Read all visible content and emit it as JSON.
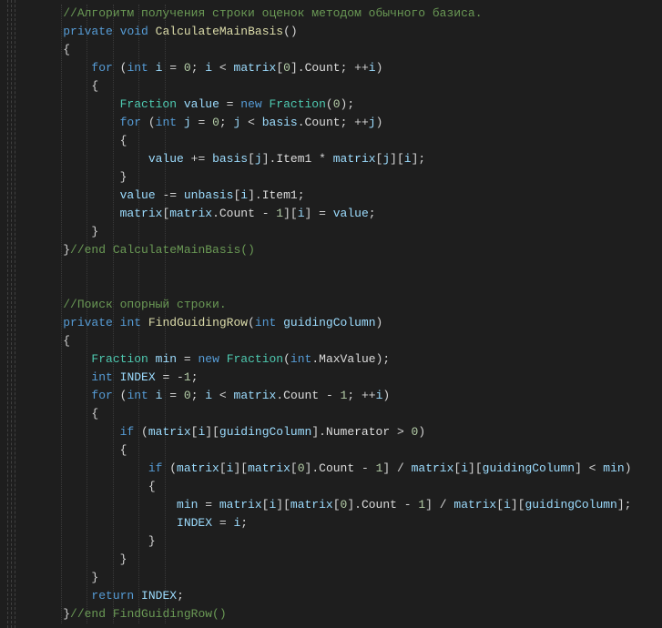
{
  "code": {
    "lines": [
      {
        "indent": 1,
        "spans": [
          {
            "cls": "c-comment",
            "t": "//Алгоритм получения строки оценок методом обычного базиса."
          }
        ]
      },
      {
        "indent": 1,
        "spans": [
          {
            "cls": "c-keyword",
            "t": "private"
          },
          {
            "cls": "c-op",
            "t": " "
          },
          {
            "cls": "c-keyword",
            "t": "void"
          },
          {
            "cls": "c-op",
            "t": " "
          },
          {
            "cls": "c-method",
            "t": "CalculateMainBasis"
          },
          {
            "cls": "c-punc",
            "t": "()"
          }
        ]
      },
      {
        "indent": 1,
        "spans": [
          {
            "cls": "c-punc",
            "t": "{"
          }
        ]
      },
      {
        "indent": 2,
        "spans": [
          {
            "cls": "c-keyword",
            "t": "for"
          },
          {
            "cls": "c-op",
            "t": " ("
          },
          {
            "cls": "c-keyword",
            "t": "int"
          },
          {
            "cls": "c-op",
            "t": " "
          },
          {
            "cls": "c-var",
            "t": "i"
          },
          {
            "cls": "c-op",
            "t": " = "
          },
          {
            "cls": "c-num",
            "t": "0"
          },
          {
            "cls": "c-op",
            "t": "; "
          },
          {
            "cls": "c-var",
            "t": "i"
          },
          {
            "cls": "c-op",
            "t": " < "
          },
          {
            "cls": "c-var",
            "t": "matrix"
          },
          {
            "cls": "c-op",
            "t": "["
          },
          {
            "cls": "c-num",
            "t": "0"
          },
          {
            "cls": "c-op",
            "t": "]."
          },
          {
            "cls": "c-white",
            "t": "Count"
          },
          {
            "cls": "c-op",
            "t": "; ++"
          },
          {
            "cls": "c-var",
            "t": "i"
          },
          {
            "cls": "c-op",
            "t": ")"
          }
        ]
      },
      {
        "indent": 2,
        "spans": [
          {
            "cls": "c-punc",
            "t": "{"
          }
        ]
      },
      {
        "indent": 3,
        "spans": [
          {
            "cls": "c-type",
            "t": "Fraction"
          },
          {
            "cls": "c-op",
            "t": " "
          },
          {
            "cls": "c-var",
            "t": "value"
          },
          {
            "cls": "c-op",
            "t": " = "
          },
          {
            "cls": "c-keyword",
            "t": "new"
          },
          {
            "cls": "c-op",
            "t": " "
          },
          {
            "cls": "c-type",
            "t": "Fraction"
          },
          {
            "cls": "c-op",
            "t": "("
          },
          {
            "cls": "c-num",
            "t": "0"
          },
          {
            "cls": "c-op",
            "t": ");"
          }
        ]
      },
      {
        "indent": 3,
        "spans": [
          {
            "cls": "c-keyword",
            "t": "for"
          },
          {
            "cls": "c-op",
            "t": " ("
          },
          {
            "cls": "c-keyword",
            "t": "int"
          },
          {
            "cls": "c-op",
            "t": " "
          },
          {
            "cls": "c-var",
            "t": "j"
          },
          {
            "cls": "c-op",
            "t": " = "
          },
          {
            "cls": "c-num",
            "t": "0"
          },
          {
            "cls": "c-op",
            "t": "; "
          },
          {
            "cls": "c-var",
            "t": "j"
          },
          {
            "cls": "c-op",
            "t": " < "
          },
          {
            "cls": "c-var",
            "t": "basis"
          },
          {
            "cls": "c-op",
            "t": "."
          },
          {
            "cls": "c-white",
            "t": "Count"
          },
          {
            "cls": "c-op",
            "t": "; ++"
          },
          {
            "cls": "c-var",
            "t": "j"
          },
          {
            "cls": "c-op",
            "t": ")"
          }
        ]
      },
      {
        "indent": 3,
        "spans": [
          {
            "cls": "c-punc",
            "t": "{"
          }
        ]
      },
      {
        "indent": 4,
        "spans": [
          {
            "cls": "c-var",
            "t": "value"
          },
          {
            "cls": "c-op",
            "t": " += "
          },
          {
            "cls": "c-var",
            "t": "basis"
          },
          {
            "cls": "c-op",
            "t": "["
          },
          {
            "cls": "c-var",
            "t": "j"
          },
          {
            "cls": "c-op",
            "t": "]."
          },
          {
            "cls": "c-white",
            "t": "Item1"
          },
          {
            "cls": "c-op",
            "t": " * "
          },
          {
            "cls": "c-var",
            "t": "matrix"
          },
          {
            "cls": "c-op",
            "t": "["
          },
          {
            "cls": "c-var",
            "t": "j"
          },
          {
            "cls": "c-op",
            "t": "]["
          },
          {
            "cls": "c-var",
            "t": "i"
          },
          {
            "cls": "c-op",
            "t": "];"
          }
        ]
      },
      {
        "indent": 3,
        "spans": [
          {
            "cls": "c-punc",
            "t": "}"
          }
        ]
      },
      {
        "indent": 3,
        "spans": [
          {
            "cls": "c-var",
            "t": "value"
          },
          {
            "cls": "c-op",
            "t": " -= "
          },
          {
            "cls": "c-var",
            "t": "unbasis"
          },
          {
            "cls": "c-op",
            "t": "["
          },
          {
            "cls": "c-var",
            "t": "i"
          },
          {
            "cls": "c-op",
            "t": "]."
          },
          {
            "cls": "c-white",
            "t": "Item1"
          },
          {
            "cls": "c-op",
            "t": ";"
          }
        ]
      },
      {
        "indent": 3,
        "spans": [
          {
            "cls": "c-var",
            "t": "matrix"
          },
          {
            "cls": "c-op",
            "t": "["
          },
          {
            "cls": "c-var",
            "t": "matrix"
          },
          {
            "cls": "c-op",
            "t": "."
          },
          {
            "cls": "c-white",
            "t": "Count"
          },
          {
            "cls": "c-op",
            "t": " - "
          },
          {
            "cls": "c-num",
            "t": "1"
          },
          {
            "cls": "c-op",
            "t": "]["
          },
          {
            "cls": "c-var",
            "t": "i"
          },
          {
            "cls": "c-op",
            "t": "] = "
          },
          {
            "cls": "c-var",
            "t": "value"
          },
          {
            "cls": "c-op",
            "t": ";"
          }
        ]
      },
      {
        "indent": 2,
        "spans": [
          {
            "cls": "c-punc",
            "t": "}"
          }
        ]
      },
      {
        "indent": 1,
        "spans": [
          {
            "cls": "c-punc",
            "t": "}"
          },
          {
            "cls": "c-comment",
            "t": "//end CalculateMainBasis()"
          }
        ]
      },
      {
        "indent": 0,
        "spans": []
      },
      {
        "indent": 0,
        "spans": []
      },
      {
        "indent": 1,
        "spans": [
          {
            "cls": "c-comment",
            "t": "//Поиск опорный строки."
          }
        ]
      },
      {
        "indent": 1,
        "spans": [
          {
            "cls": "c-keyword",
            "t": "private"
          },
          {
            "cls": "c-op",
            "t": " "
          },
          {
            "cls": "c-keyword",
            "t": "int"
          },
          {
            "cls": "c-op",
            "t": " "
          },
          {
            "cls": "c-method",
            "t": "FindGuidingRow"
          },
          {
            "cls": "c-op",
            "t": "("
          },
          {
            "cls": "c-keyword",
            "t": "int"
          },
          {
            "cls": "c-op",
            "t": " "
          },
          {
            "cls": "c-var",
            "t": "guidingColumn"
          },
          {
            "cls": "c-op",
            "t": ")"
          }
        ]
      },
      {
        "indent": 1,
        "spans": [
          {
            "cls": "c-punc",
            "t": "{"
          }
        ]
      },
      {
        "indent": 2,
        "spans": [
          {
            "cls": "c-type",
            "t": "Fraction"
          },
          {
            "cls": "c-op",
            "t": " "
          },
          {
            "cls": "c-var",
            "t": "min"
          },
          {
            "cls": "c-op",
            "t": " = "
          },
          {
            "cls": "c-keyword",
            "t": "new"
          },
          {
            "cls": "c-op",
            "t": " "
          },
          {
            "cls": "c-type",
            "t": "Fraction"
          },
          {
            "cls": "c-op",
            "t": "("
          },
          {
            "cls": "c-keyword",
            "t": "int"
          },
          {
            "cls": "c-op",
            "t": "."
          },
          {
            "cls": "c-white",
            "t": "MaxValue"
          },
          {
            "cls": "c-op",
            "t": ");"
          }
        ]
      },
      {
        "indent": 2,
        "spans": [
          {
            "cls": "c-keyword",
            "t": "int"
          },
          {
            "cls": "c-op",
            "t": " "
          },
          {
            "cls": "c-var",
            "t": "INDEX"
          },
          {
            "cls": "c-op",
            "t": " = -"
          },
          {
            "cls": "c-num",
            "t": "1"
          },
          {
            "cls": "c-op",
            "t": ";"
          }
        ]
      },
      {
        "indent": 2,
        "spans": [
          {
            "cls": "c-keyword",
            "t": "for"
          },
          {
            "cls": "c-op",
            "t": " ("
          },
          {
            "cls": "c-keyword",
            "t": "int"
          },
          {
            "cls": "c-op",
            "t": " "
          },
          {
            "cls": "c-var",
            "t": "i"
          },
          {
            "cls": "c-op",
            "t": " = "
          },
          {
            "cls": "c-num",
            "t": "0"
          },
          {
            "cls": "c-op",
            "t": "; "
          },
          {
            "cls": "c-var",
            "t": "i"
          },
          {
            "cls": "c-op",
            "t": " < "
          },
          {
            "cls": "c-var",
            "t": "matrix"
          },
          {
            "cls": "c-op",
            "t": "."
          },
          {
            "cls": "c-white",
            "t": "Count"
          },
          {
            "cls": "c-op",
            "t": " - "
          },
          {
            "cls": "c-num",
            "t": "1"
          },
          {
            "cls": "c-op",
            "t": "; ++"
          },
          {
            "cls": "c-var",
            "t": "i"
          },
          {
            "cls": "c-op",
            "t": ")"
          }
        ]
      },
      {
        "indent": 2,
        "spans": [
          {
            "cls": "c-punc",
            "t": "{"
          }
        ]
      },
      {
        "indent": 3,
        "spans": [
          {
            "cls": "c-keyword",
            "t": "if"
          },
          {
            "cls": "c-op",
            "t": " ("
          },
          {
            "cls": "c-var",
            "t": "matrix"
          },
          {
            "cls": "c-op",
            "t": "["
          },
          {
            "cls": "c-var",
            "t": "i"
          },
          {
            "cls": "c-op",
            "t": "]["
          },
          {
            "cls": "c-var",
            "t": "guidingColumn"
          },
          {
            "cls": "c-op",
            "t": "]."
          },
          {
            "cls": "c-white",
            "t": "Numerator"
          },
          {
            "cls": "c-op",
            "t": " > "
          },
          {
            "cls": "c-num",
            "t": "0"
          },
          {
            "cls": "c-op",
            "t": ")"
          }
        ]
      },
      {
        "indent": 3,
        "spans": [
          {
            "cls": "c-punc",
            "t": "{"
          }
        ]
      },
      {
        "indent": 4,
        "spans": [
          {
            "cls": "c-keyword",
            "t": "if"
          },
          {
            "cls": "c-op",
            "t": " ("
          },
          {
            "cls": "c-var",
            "t": "matrix"
          },
          {
            "cls": "c-op",
            "t": "["
          },
          {
            "cls": "c-var",
            "t": "i"
          },
          {
            "cls": "c-op",
            "t": "]["
          },
          {
            "cls": "c-var",
            "t": "matrix"
          },
          {
            "cls": "c-op",
            "t": "["
          },
          {
            "cls": "c-num",
            "t": "0"
          },
          {
            "cls": "c-op",
            "t": "]."
          },
          {
            "cls": "c-white",
            "t": "Count"
          },
          {
            "cls": "c-op",
            "t": " - "
          },
          {
            "cls": "c-num",
            "t": "1"
          },
          {
            "cls": "c-op",
            "t": "] / "
          },
          {
            "cls": "c-var",
            "t": "matrix"
          },
          {
            "cls": "c-op",
            "t": "["
          },
          {
            "cls": "c-var",
            "t": "i"
          },
          {
            "cls": "c-op",
            "t": "]["
          },
          {
            "cls": "c-var",
            "t": "guidingColumn"
          },
          {
            "cls": "c-op",
            "t": "] < "
          },
          {
            "cls": "c-var",
            "t": "min"
          },
          {
            "cls": "c-op",
            "t": ")"
          }
        ]
      },
      {
        "indent": 4,
        "spans": [
          {
            "cls": "c-punc",
            "t": "{"
          }
        ]
      },
      {
        "indent": 5,
        "spans": [
          {
            "cls": "c-var",
            "t": "min"
          },
          {
            "cls": "c-op",
            "t": " = "
          },
          {
            "cls": "c-var",
            "t": "matrix"
          },
          {
            "cls": "c-op",
            "t": "["
          },
          {
            "cls": "c-var",
            "t": "i"
          },
          {
            "cls": "c-op",
            "t": "]["
          },
          {
            "cls": "c-var",
            "t": "matrix"
          },
          {
            "cls": "c-op",
            "t": "["
          },
          {
            "cls": "c-num",
            "t": "0"
          },
          {
            "cls": "c-op",
            "t": "]."
          },
          {
            "cls": "c-white",
            "t": "Count"
          },
          {
            "cls": "c-op",
            "t": " - "
          },
          {
            "cls": "c-num",
            "t": "1"
          },
          {
            "cls": "c-op",
            "t": "] / "
          },
          {
            "cls": "c-var",
            "t": "matrix"
          },
          {
            "cls": "c-op",
            "t": "["
          },
          {
            "cls": "c-var",
            "t": "i"
          },
          {
            "cls": "c-op",
            "t": "]["
          },
          {
            "cls": "c-var",
            "t": "guidingColumn"
          },
          {
            "cls": "c-op",
            "t": "];"
          }
        ]
      },
      {
        "indent": 5,
        "spans": [
          {
            "cls": "c-var",
            "t": "INDEX"
          },
          {
            "cls": "c-op",
            "t": " = "
          },
          {
            "cls": "c-var",
            "t": "i"
          },
          {
            "cls": "c-op",
            "t": ";"
          }
        ]
      },
      {
        "indent": 4,
        "spans": [
          {
            "cls": "c-punc",
            "t": "}"
          }
        ]
      },
      {
        "indent": 3,
        "spans": [
          {
            "cls": "c-punc",
            "t": "}"
          }
        ]
      },
      {
        "indent": 2,
        "spans": [
          {
            "cls": "c-punc",
            "t": "}"
          }
        ]
      },
      {
        "indent": 2,
        "spans": [
          {
            "cls": "c-keyword",
            "t": "return"
          },
          {
            "cls": "c-op",
            "t": " "
          },
          {
            "cls": "c-var",
            "t": "INDEX"
          },
          {
            "cls": "c-op",
            "t": ";"
          }
        ]
      },
      {
        "indent": 1,
        "spans": [
          {
            "cls": "c-punc",
            "t": "}"
          },
          {
            "cls": "c-comment",
            "t": "//end FindGuidingRow()"
          }
        ]
      }
    ]
  }
}
